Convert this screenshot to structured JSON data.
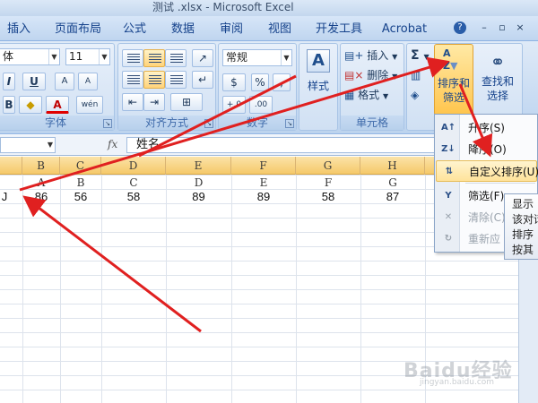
{
  "window": {
    "title": "测试 .xlsx - Microsoft Excel"
  },
  "tabs": [
    "插入",
    "页面布局",
    "公式",
    "数据",
    "审阅",
    "视图",
    "开发工具",
    "Acrobat"
  ],
  "window_controls": {
    "help": "?",
    "minimize": "–",
    "restore": "▫",
    "close": "×"
  },
  "ribbon": {
    "font_group": {
      "label": "字体",
      "font_name": "体",
      "font_size": "11",
      "bold": "B",
      "underline": "U",
      "italic": "I",
      "font_color": "A",
      "phonetic": "wén",
      "font_size_up": "A",
      "font_size_down": "A"
    },
    "alignment_group": {
      "label": "对齐方式"
    },
    "number_group": {
      "label": "数字",
      "format": "常规",
      "currency": "$",
      "percent": "%",
      "comma": ",",
      "inc_decimal": "+.0",
      "dec_decimal": ".00"
    },
    "styles_group": {
      "label": "样式"
    },
    "cells_group": {
      "label": "单元格",
      "insert": "插入",
      "delete": "删除",
      "format": "格式"
    },
    "editing_group": {
      "sigma": "Σ",
      "sort_filter": "排序和\n筛选",
      "find_select": "查找和\n选择"
    }
  },
  "formula_bar": {
    "fx": "fx",
    "value": "姓名"
  },
  "columns": [
    "B",
    "C",
    "D",
    "E",
    "F",
    "G",
    "H"
  ],
  "rows": [
    {
      "label": "",
      "cells": [
        "A",
        "B",
        "C",
        "D",
        "E",
        "F",
        "G"
      ]
    },
    {
      "label": "J",
      "cells": [
        "86",
        "56",
        "58",
        "89",
        "89",
        "58",
        "87"
      ]
    }
  ],
  "sort_menu": {
    "items": [
      {
        "icon": "A↑",
        "label": "升序(S)",
        "disabled": false
      },
      {
        "icon": "Z↓",
        "label": "降序(O)",
        "disabled": false
      },
      {
        "icon": "⇅",
        "label": "自定义排序(U)...",
        "disabled": false
      },
      {
        "icon": "Y",
        "label": "筛选(F)",
        "disabled": false
      },
      {
        "icon": "✕",
        "label": "清除(C)",
        "disabled": true
      },
      {
        "icon": "↻",
        "label": "重新应",
        "disabled": true
      }
    ]
  },
  "tooltip": {
    "lines": [
      "显示",
      "该对话",
      "排序",
      "按其"
    ]
  },
  "watermark": {
    "text": "Baidu经验",
    "sub": "jingyan.baidu.com"
  },
  "colors": {
    "ribbon_bg": "#c6daf2",
    "col_header": "#f5c96a",
    "accent_red": "#e02020",
    "highlight": "#ffc54d"
  }
}
